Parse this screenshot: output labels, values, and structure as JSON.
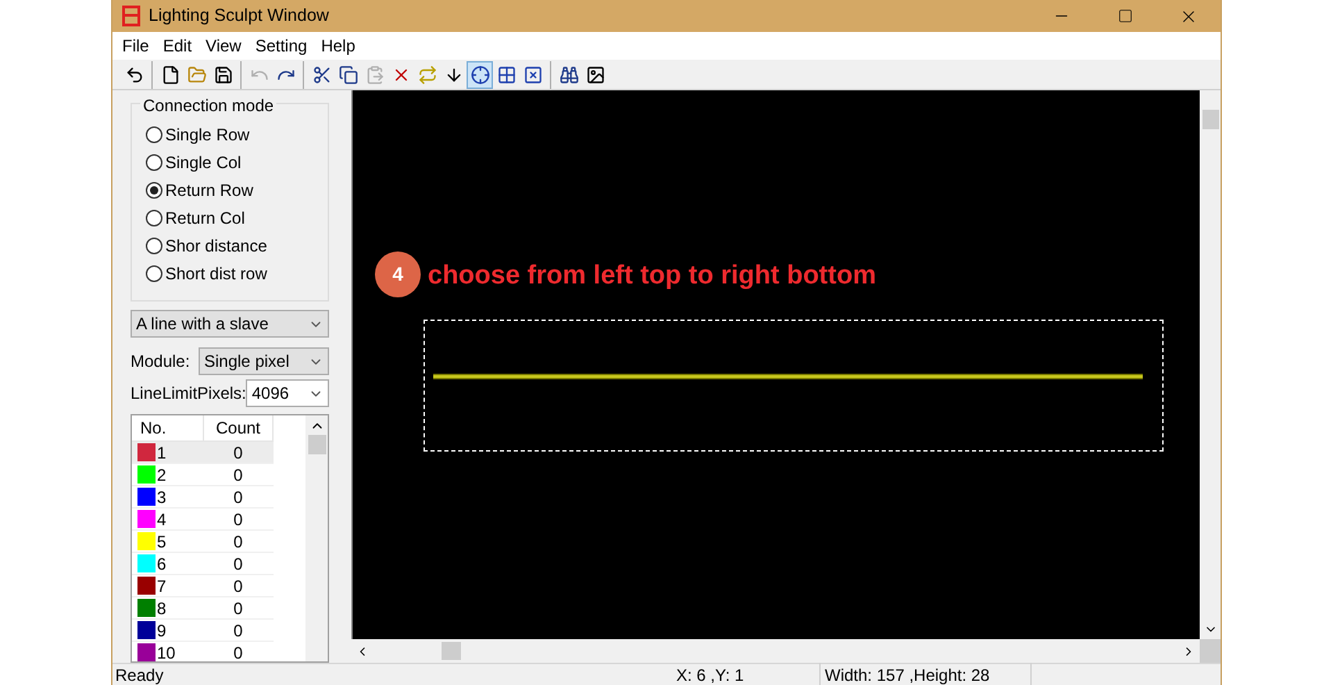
{
  "window": {
    "title": "Lighting Sculpt Window"
  },
  "menu": [
    "File",
    "Edit",
    "View",
    "Setting",
    "Help"
  ],
  "toolbar": [
    [
      {
        "selected": false,
        "disabled": false
      }
    ],
    [
      {
        "selected": false,
        "disabled": false
      },
      {
        "selected": false,
        "disabled": false
      },
      {
        "selected": false,
        "disabled": false
      }
    ],
    [
      {
        "selected": false,
        "disabled": true
      },
      {
        "selected": false,
        "disabled": false
      }
    ],
    [
      {
        "selected": false,
        "disabled": false
      },
      {
        "selected": false,
        "disabled": false
      },
      {
        "selected": false,
        "disabled": true
      },
      {
        "selected": false,
        "disabled": false
      },
      {
        "selected": false,
        "disabled": false
      },
      {
        "selected": false,
        "disabled": false
      },
      {
        "selected": true,
        "disabled": false
      },
      {
        "selected": false,
        "disabled": false
      },
      {
        "selected": false,
        "disabled": false
      }
    ],
    [
      {
        "selected": false,
        "disabled": false
      },
      {
        "selected": false,
        "disabled": false
      }
    ]
  ],
  "connection_mode": {
    "title": "Connection mode",
    "options": [
      {
        "label": "Single Row",
        "selected": false
      },
      {
        "label": "Single Col",
        "selected": false
      },
      {
        "label": "Return Row",
        "selected": true
      },
      {
        "label": "Return Col",
        "selected": false
      },
      {
        "label": "Shor distance",
        "selected": false
      },
      {
        "label": "Short dist row",
        "selected": false
      }
    ]
  },
  "mode_select": {
    "value": "A line with a slave"
  },
  "module": {
    "label": "Module:",
    "value": "Single pixel"
  },
  "line_limit": {
    "label": "LineLimitPixels:",
    "value": "4096"
  },
  "table": {
    "columns": [
      "No.",
      "Count"
    ],
    "rows": [
      {
        "color": "#d0273e",
        "no": "1",
        "count": "0",
        "selected": true
      },
      {
        "color": "#00ff00",
        "no": "2",
        "count": "0",
        "selected": false
      },
      {
        "color": "#0000ff",
        "no": "3",
        "count": "0",
        "selected": false
      },
      {
        "color": "#ff00ff",
        "no": "4",
        "count": "0",
        "selected": false
      },
      {
        "color": "#ffff00",
        "no": "5",
        "count": "0",
        "selected": false
      },
      {
        "color": "#00ffff",
        "no": "6",
        "count": "0",
        "selected": false
      },
      {
        "color": "#990000",
        "no": "7",
        "count": "0",
        "selected": false
      },
      {
        "color": "#007f00",
        "no": "8",
        "count": "0",
        "selected": false
      },
      {
        "color": "#000099",
        "no": "9",
        "count": "0",
        "selected": false
      },
      {
        "color": "#990099",
        "no": "10",
        "count": "0",
        "selected": false
      }
    ]
  },
  "canvas": {
    "step": "4",
    "instruction": "choose from left top to right bottom"
  },
  "status_bar": [
    "Ready",
    "X: 6 ,Y: 1",
    "Width: 157 ,Height: 28"
  ]
}
